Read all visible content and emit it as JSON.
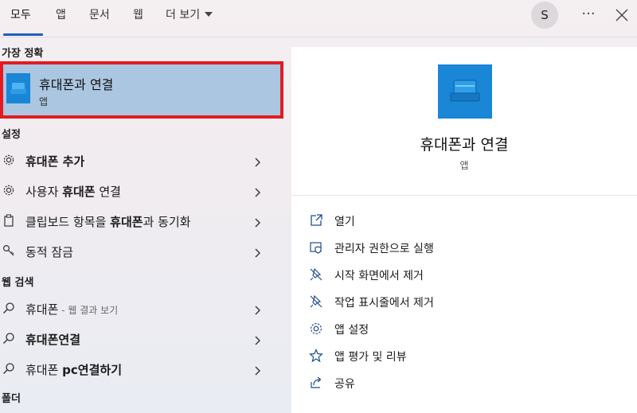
{
  "tabs": [
    {
      "label": "모두"
    },
    {
      "label": "앱"
    },
    {
      "label": "문서"
    },
    {
      "label": "웹"
    },
    {
      "label": "더 보기"
    }
  ],
  "user": {
    "initial": "S"
  },
  "more_label": "···",
  "sections": {
    "best_match": "가장 정확",
    "settings": "설정",
    "web_search": "웹 검색",
    "folders": "폴더"
  },
  "best_match": {
    "title": "휴대폰과 연결",
    "subtitle": "앱"
  },
  "settings_items": [
    {
      "prefix": "",
      "bold": "휴대폰 추가",
      "suffix": ""
    },
    {
      "prefix": "사용자 ",
      "bold": "휴대폰",
      "suffix": " 연결"
    },
    {
      "prefix": "클립보드 항목을 ",
      "bold": "휴대폰",
      "suffix": "과 동기화"
    },
    {
      "prefix": "동적 잠금",
      "bold": "",
      "suffix": ""
    }
  ],
  "web_items": [
    {
      "bold": "휴대폰",
      "plain": "",
      "note": " - 웹 결과 보기"
    },
    {
      "bold": "휴대폰연결",
      "plain": "",
      "note": ""
    },
    {
      "bold": "",
      "plain": "휴대폰 ",
      "bold2": "pc연결하기",
      "note": ""
    }
  ],
  "detail": {
    "name": "휴대폰과 연결",
    "type": "앱",
    "actions": [
      {
        "label": "열기",
        "icon": "open-icon"
      },
      {
        "label": "관리자 권한으로 실행",
        "icon": "shield-icon"
      },
      {
        "label": "시작 화면에서 제거",
        "icon": "unpin-icon"
      },
      {
        "label": "작업 표시줄에서 제거",
        "icon": "unpin-icon"
      },
      {
        "label": "앱 설정",
        "icon": "gear-icon"
      },
      {
        "label": "앱 평가 및 리뷰",
        "icon": "star-icon"
      },
      {
        "label": "공유",
        "icon": "share-icon"
      }
    ]
  },
  "colors": {
    "accent": "#1f5fbf",
    "highlight_border": "#e21b22",
    "highlight_fill": "#aac6e0",
    "app_icon": "#1a86d6"
  }
}
